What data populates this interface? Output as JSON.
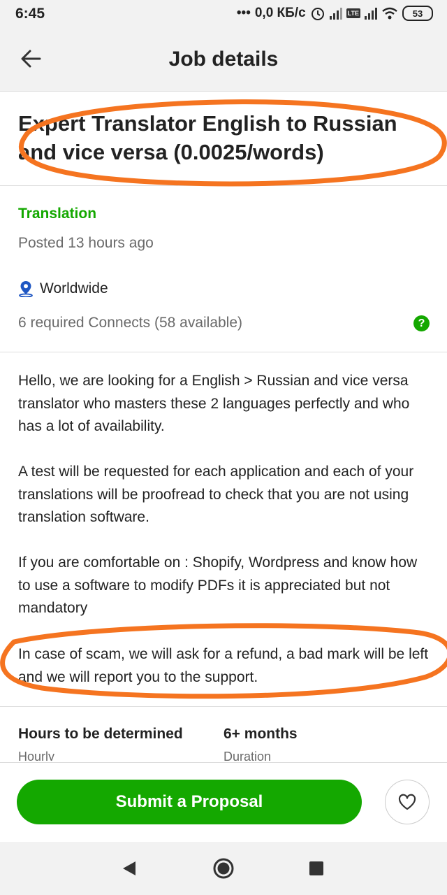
{
  "status_bar": {
    "time": "6:45",
    "network_speed": "0,0 КБ/с",
    "lte_badge": "LTE",
    "battery": "53",
    "icons": [
      "dots-icon",
      "alarm-icon",
      "signal-icon",
      "lte-icon",
      "signal-icon",
      "wifi-icon",
      "battery-icon"
    ]
  },
  "header": {
    "title": "Job details",
    "back_icon": "arrow-left-icon"
  },
  "job": {
    "title": "Expert Translator English to Russian and vice versa (0.0025/words)",
    "category": "Translation",
    "posted": "Posted 13 hours ago",
    "location": "Worldwide",
    "location_icon": "map-pin-icon",
    "connects": "6 required Connects (58 available)",
    "help_icon": "?",
    "description": [
      "Hello, we are looking for a English > Russian and vice versa translator who masters these 2 languages perfectly and who has a lot of availability.",
      "A test will be requested for each application and each of your translations will be proofread to check that you are not using translation software.",
      "If you are comfortable on : Shopify, Wordpress and know how to use a software to modify PDFs it is appreciated but not mandatory",
      "In case of scam, we will ask for a refund, a bad mark will be left and we will report you to the support."
    ],
    "terms": [
      {
        "label": "Hours to be determined",
        "sub": "Hourly"
      },
      {
        "label": "6+ months",
        "sub": "Duration"
      }
    ]
  },
  "actions": {
    "submit_label": "Submit a Proposal",
    "save_icon": "heart-icon"
  },
  "nav": {
    "icons": [
      "back-triangle-icon",
      "home-circle-icon",
      "recents-square-icon"
    ]
  },
  "colors": {
    "accent_green": "#14a800",
    "annotation_orange": "#f57420",
    "background": "#f2f2f2"
  }
}
